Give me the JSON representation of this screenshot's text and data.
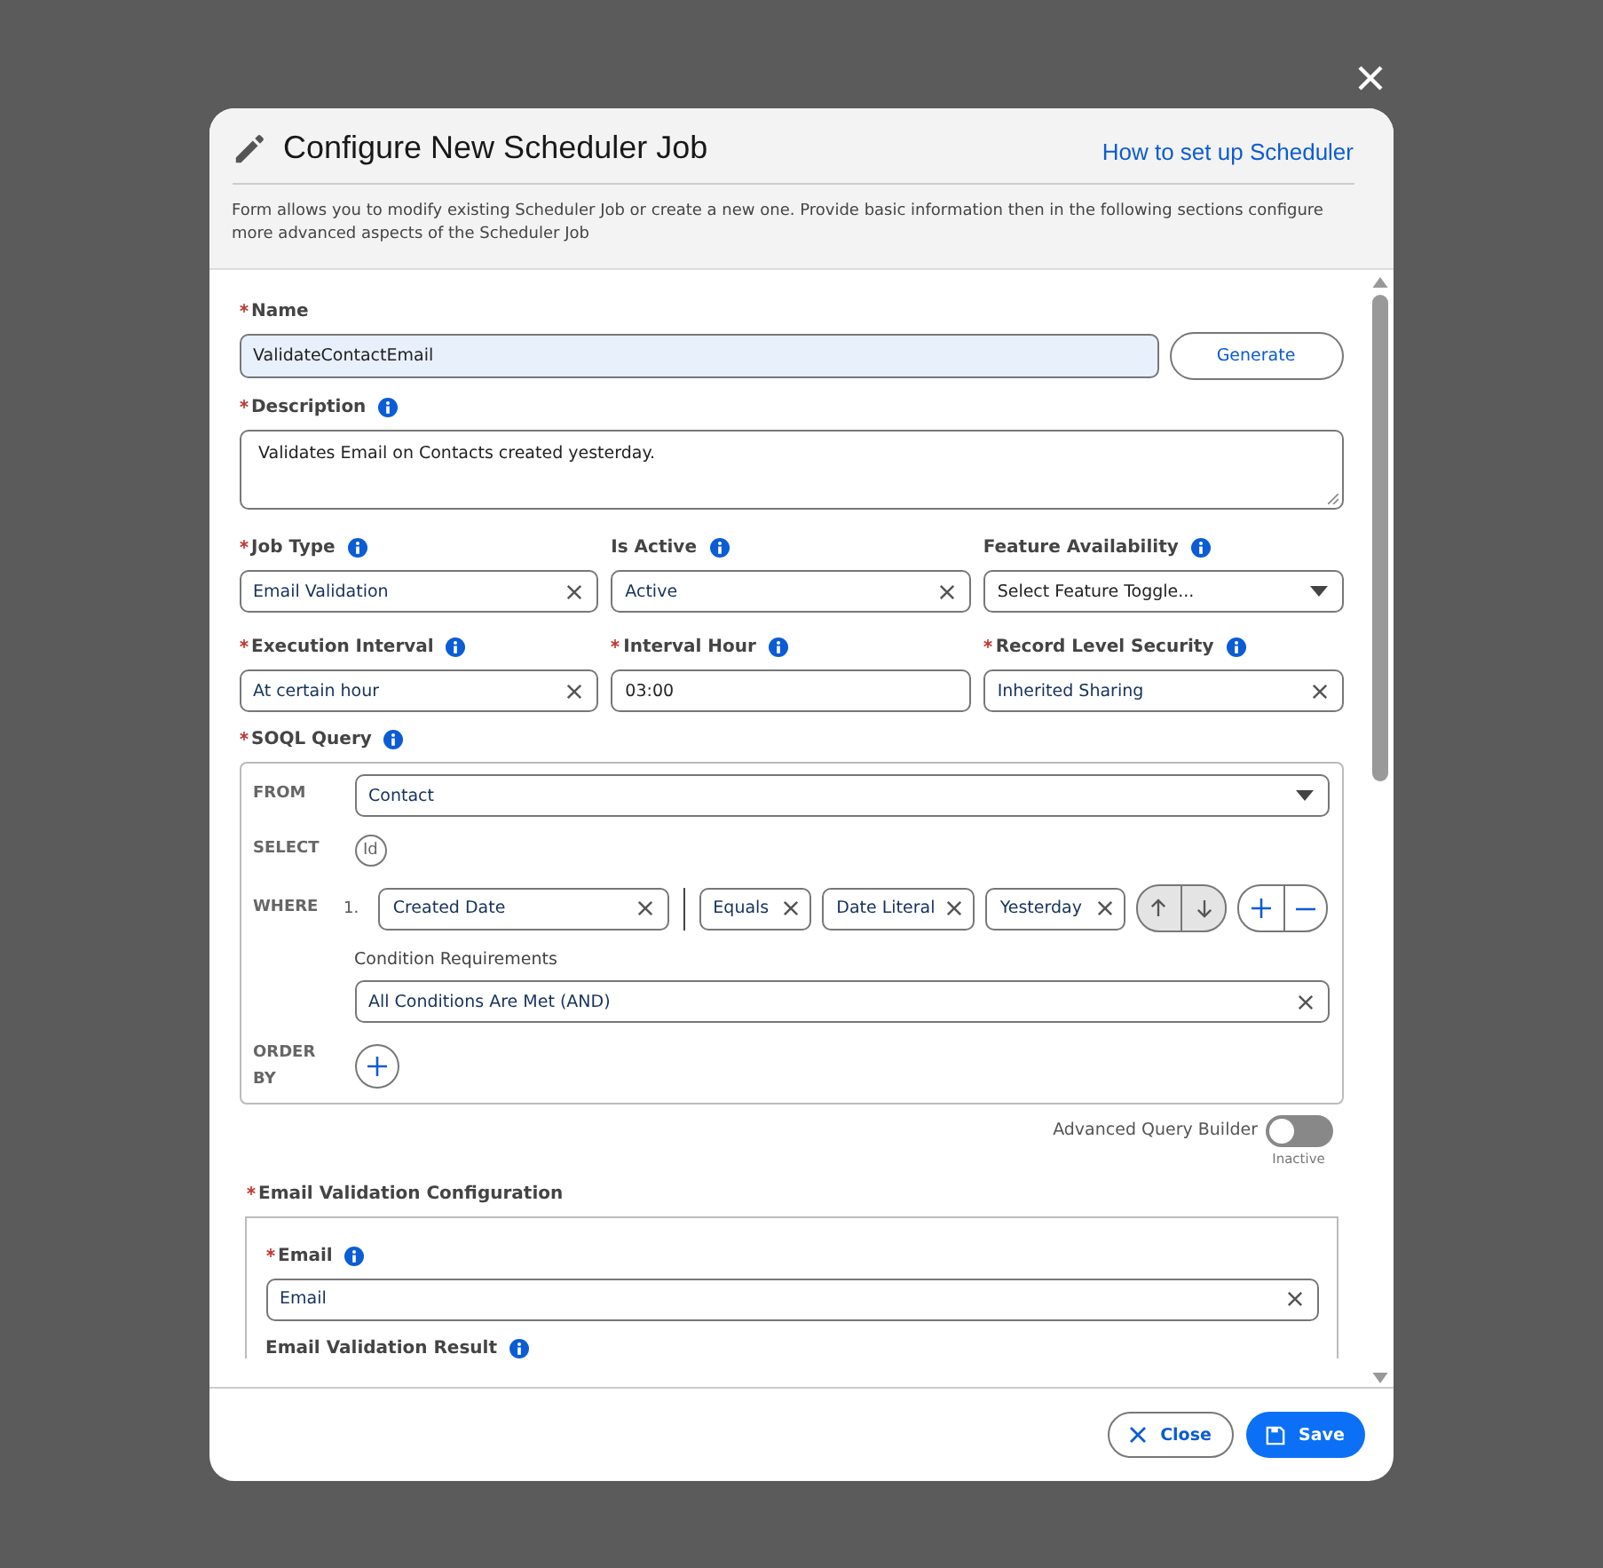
{
  "modal": {
    "title": "Configure New Scheduler Job",
    "help_link": "How to set up Scheduler",
    "description": "Form allows you to modify existing Scheduler Job or create a new one. Provide basic information then in the following sections configure more advanced aspects of the Scheduler Job"
  },
  "name_field": {
    "label": "Name",
    "required": true,
    "value": "ValidateContactEmail",
    "button": "Generate"
  },
  "description_field": {
    "label": "Description",
    "required": true,
    "info": true,
    "value": "Validates Email on Contacts created yesterday."
  },
  "field_rows": [
    [
      {
        "label": "Job Type",
        "required": true,
        "info": true,
        "kind": "clearable",
        "value": "Email Validation"
      },
      {
        "label": "Is Active",
        "required": false,
        "info": true,
        "kind": "clearable",
        "value": "Active"
      },
      {
        "label": "Feature Availability",
        "required": false,
        "info": true,
        "kind": "dropdown",
        "placeholder": "Select Feature Toggle..."
      }
    ],
    [
      {
        "label": "Execution Interval",
        "required": true,
        "info": true,
        "kind": "clearable",
        "value": "At certain hour"
      },
      {
        "label": "Interval Hour",
        "required": true,
        "info": true,
        "kind": "text",
        "value": "03:00"
      },
      {
        "label": "Record Level Security",
        "required": true,
        "info": true,
        "kind": "clearable",
        "value": "Inherited Sharing"
      }
    ]
  ],
  "soql": {
    "label": "SOQL Query",
    "required": true,
    "info": true,
    "from_label": "FROM",
    "from_value": "Contact",
    "select_label": "SELECT",
    "select_chip": "Id",
    "where_label": "WHERE",
    "conditions": [
      {
        "number": "1.",
        "field": "Created Date",
        "operator": "Equals",
        "value_type": "Date Literal",
        "value": "Yesterday"
      }
    ],
    "requirements_label": "Condition Requirements",
    "requirements_value": "All Conditions Are Met (AND)",
    "order_label": "ORDER BY"
  },
  "advanced_toggle": {
    "label": "Advanced Query Builder",
    "on": false,
    "state_text": "Inactive"
  },
  "email_config": {
    "label": "Email Validation Configuration",
    "required": true,
    "fields": [
      {
        "label": "Email",
        "required": true,
        "info": true,
        "value": "Email"
      },
      {
        "label": "Email Validation Result",
        "required": false,
        "info": true
      }
    ]
  },
  "footer": {
    "close": "Close",
    "save": "Save"
  }
}
